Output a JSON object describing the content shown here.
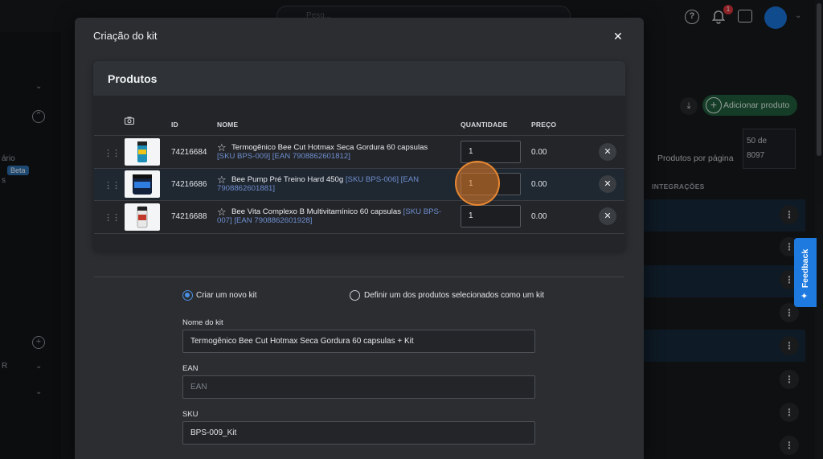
{
  "background": {
    "search_placeholder": "Pesq...",
    "notification_count": "1",
    "sidebar_text_1": "ário",
    "sidebar_beta": "Beta",
    "sidebar_text_2": "s",
    "sidebar_text_3": "R",
    "add_product_label": "Adicionar produto",
    "per_page_label": "Produtos por página",
    "per_page_value_1": "50 de",
    "per_page_value_2": "8097",
    "integrations_header": "INTEGRAÇÕES",
    "feedback_label": "Feedback"
  },
  "modal": {
    "title": "Criação do kit",
    "products_title": "Produtos",
    "columns": {
      "id": "ID",
      "name": "NOME",
      "quantity": "QUANTIDADE",
      "price": "PREÇO"
    },
    "products": [
      {
        "id": "74216684",
        "name": "Termogênico Bee Cut Hotmax Seca Gordura 60 capsulas",
        "sku": "[SKU BPS-009] [EAN 7908862601812]",
        "quantity": "1",
        "price": "0.00",
        "thumb_color": "#1d8fb8"
      },
      {
        "id": "74216686",
        "name": "Bee Pump Pré Treino Hard 450g",
        "sku": "[SKU BPS-006] [EAN 7908862601881]",
        "quantity": "1",
        "price": "0.00",
        "thumb_color": "#1e4f9a"
      },
      {
        "id": "74216688",
        "name": "Bee Vita Complexo B Multivitamínico 60 capsulas",
        "sku": "[SKU BPS-007] [EAN 7908862601928]",
        "quantity": "1",
        "price": "0.00",
        "thumb_color": "#c0392b"
      }
    ],
    "option_new_kit": "Criar um novo kit",
    "option_existing_kit": "Definir um dos produtos selecionados como um kit",
    "kit_name_label": "Nome do kit",
    "kit_name_value": "Termogênico Bee Cut Hotmax Seca Gordura 60 capsulas + Kit",
    "ean_label": "EAN",
    "ean_placeholder": "EAN",
    "sku_label": "SKU",
    "sku_value": "BPS-009_Kit"
  }
}
